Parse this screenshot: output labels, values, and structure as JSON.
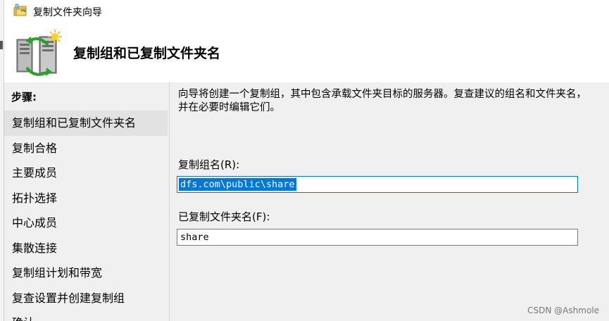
{
  "window": {
    "title": "复制文件夹向导"
  },
  "header": {
    "title": "复制组和已复制文件夹名"
  },
  "steps": {
    "heading": "步骤:",
    "items": [
      {
        "label": "复制组和已复制文件夹名",
        "current": true
      },
      {
        "label": "复制合格",
        "current": false
      },
      {
        "label": "主要成员",
        "current": false
      },
      {
        "label": "拓扑选择",
        "current": false
      },
      {
        "label": "中心成员",
        "current": false
      },
      {
        "label": "集散连接",
        "current": false
      },
      {
        "label": "复制组计划和带宽",
        "current": false
      },
      {
        "label": "复查设置并创建复制组",
        "current": false
      },
      {
        "label": "确认",
        "current": false
      }
    ]
  },
  "content": {
    "description": "向导将创建一个复制组，其中包含承载文件夹目标的服务器。复查建议的组名和文件夹名，并在必要时编辑它们。",
    "group_name_label": "复制组名(R):",
    "group_name_value": "dfs.com\\public\\share",
    "folder_name_label": "已复制文件夹名(F):",
    "folder_name_value": "share"
  },
  "watermark": "CSDN @Ashmole",
  "colors": {
    "selection": "#0078d7",
    "panel": "#f0f0f0",
    "current_step": "#e2e2e2"
  }
}
